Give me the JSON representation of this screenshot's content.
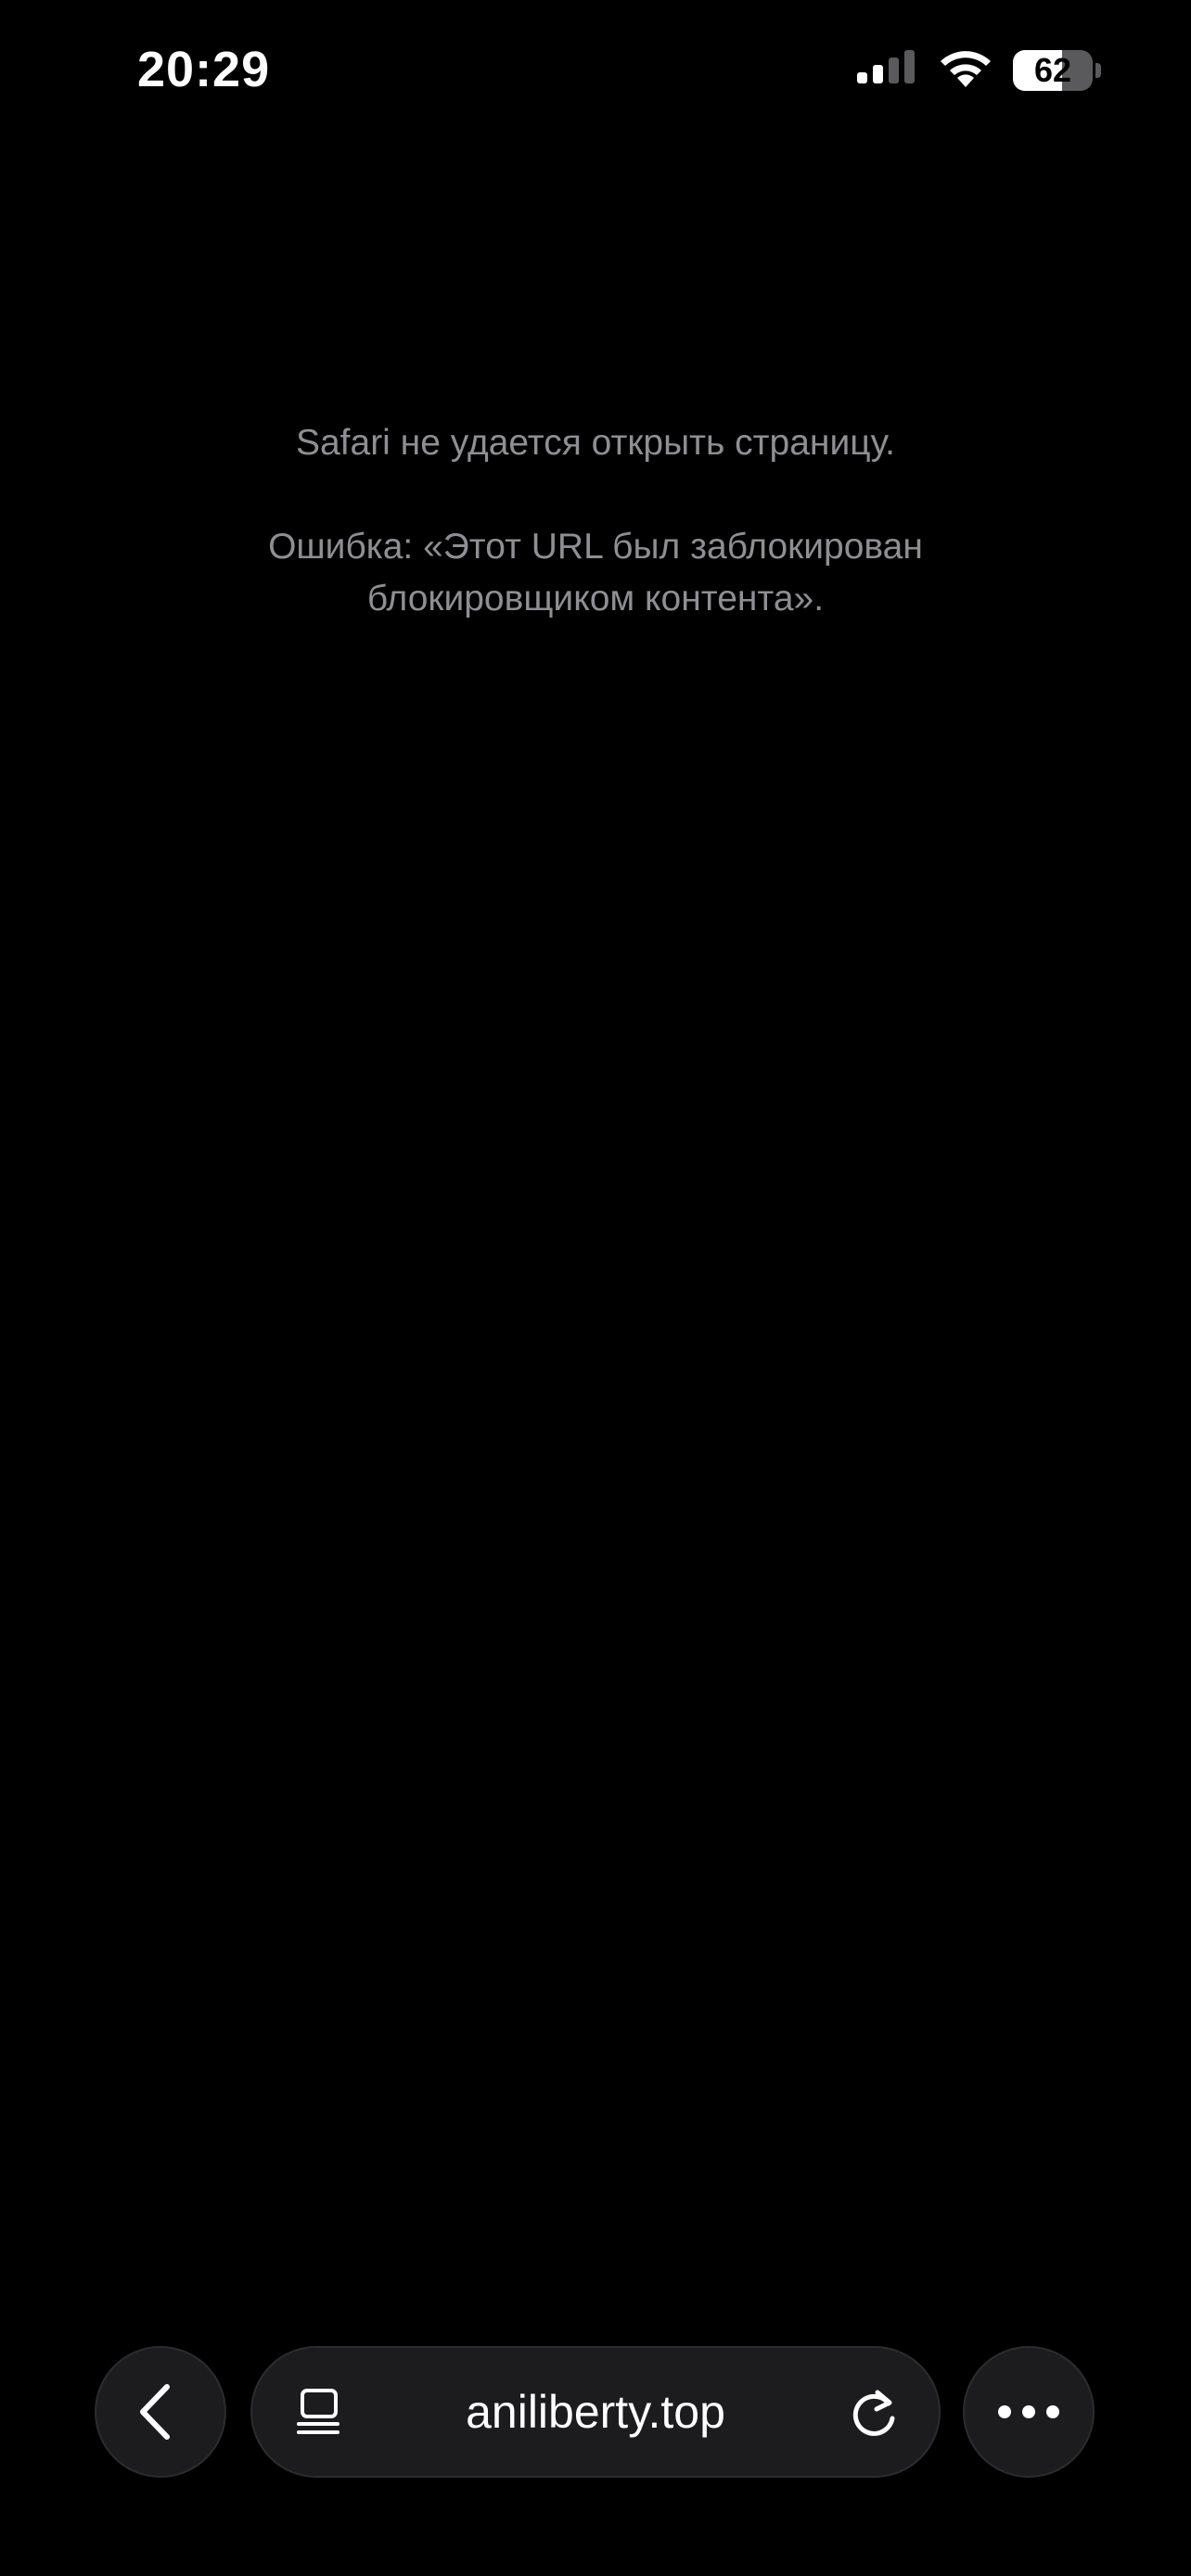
{
  "status_bar": {
    "time": "20:29",
    "battery_level": "62",
    "battery_fraction": 0.62,
    "signal_icon": "cellular-signal-icon",
    "wifi_icon": "wifi-icon"
  },
  "error": {
    "title": "Safari не удается открыть страницу.",
    "detail": "Ошибка: «Этот URL был заблокирован блокировщиком контента»."
  },
  "toolbar": {
    "back_icon": "chevron-left-icon",
    "page_menu_icon": "page-menu-icon",
    "address": "aniliberty.top",
    "reload_icon": "reload-icon",
    "more_icon": "more-icon"
  },
  "colors": {
    "background": "#000000",
    "text_secondary": "#8e8e93",
    "toolbar_button": "#1c1c1e",
    "toolbar_border": "#2c2c2e",
    "foreground": "#ffffff"
  }
}
